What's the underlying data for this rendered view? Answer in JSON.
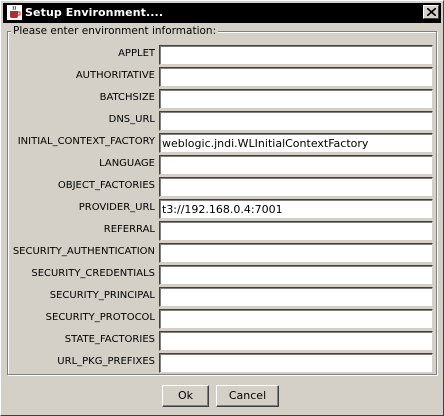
{
  "window": {
    "title": "Setup Environment....",
    "icon": "java-cup-icon"
  },
  "group_label": "Please enter environment information:",
  "fields": [
    {
      "label": "APPLET",
      "value": ""
    },
    {
      "label": "AUTHORITATIVE",
      "value": ""
    },
    {
      "label": "BATCHSIZE",
      "value": ""
    },
    {
      "label": "DNS_URL",
      "value": ""
    },
    {
      "label": "INITIAL_CONTEXT_FACTORY",
      "value": "weblogic.jndi.WLInitialContextFactory"
    },
    {
      "label": "LANGUAGE",
      "value": ""
    },
    {
      "label": "OBJECT_FACTORIES",
      "value": ""
    },
    {
      "label": "PROVIDER_URL",
      "value": "t3://192.168.0.4:7001"
    },
    {
      "label": "REFERRAL",
      "value": ""
    },
    {
      "label": "SECURITY_AUTHENTICATION",
      "value": ""
    },
    {
      "label": "SECURITY_CREDENTIALS",
      "value": ""
    },
    {
      "label": "SECURITY_PRINCIPAL",
      "value": ""
    },
    {
      "label": "SECURITY_PROTOCOL",
      "value": ""
    },
    {
      "label": "STATE_FACTORIES",
      "value": ""
    },
    {
      "label": "URL_PKG_PREFIXES",
      "value": ""
    }
  ],
  "buttons": {
    "ok": "Ok",
    "cancel": "Cancel"
  }
}
